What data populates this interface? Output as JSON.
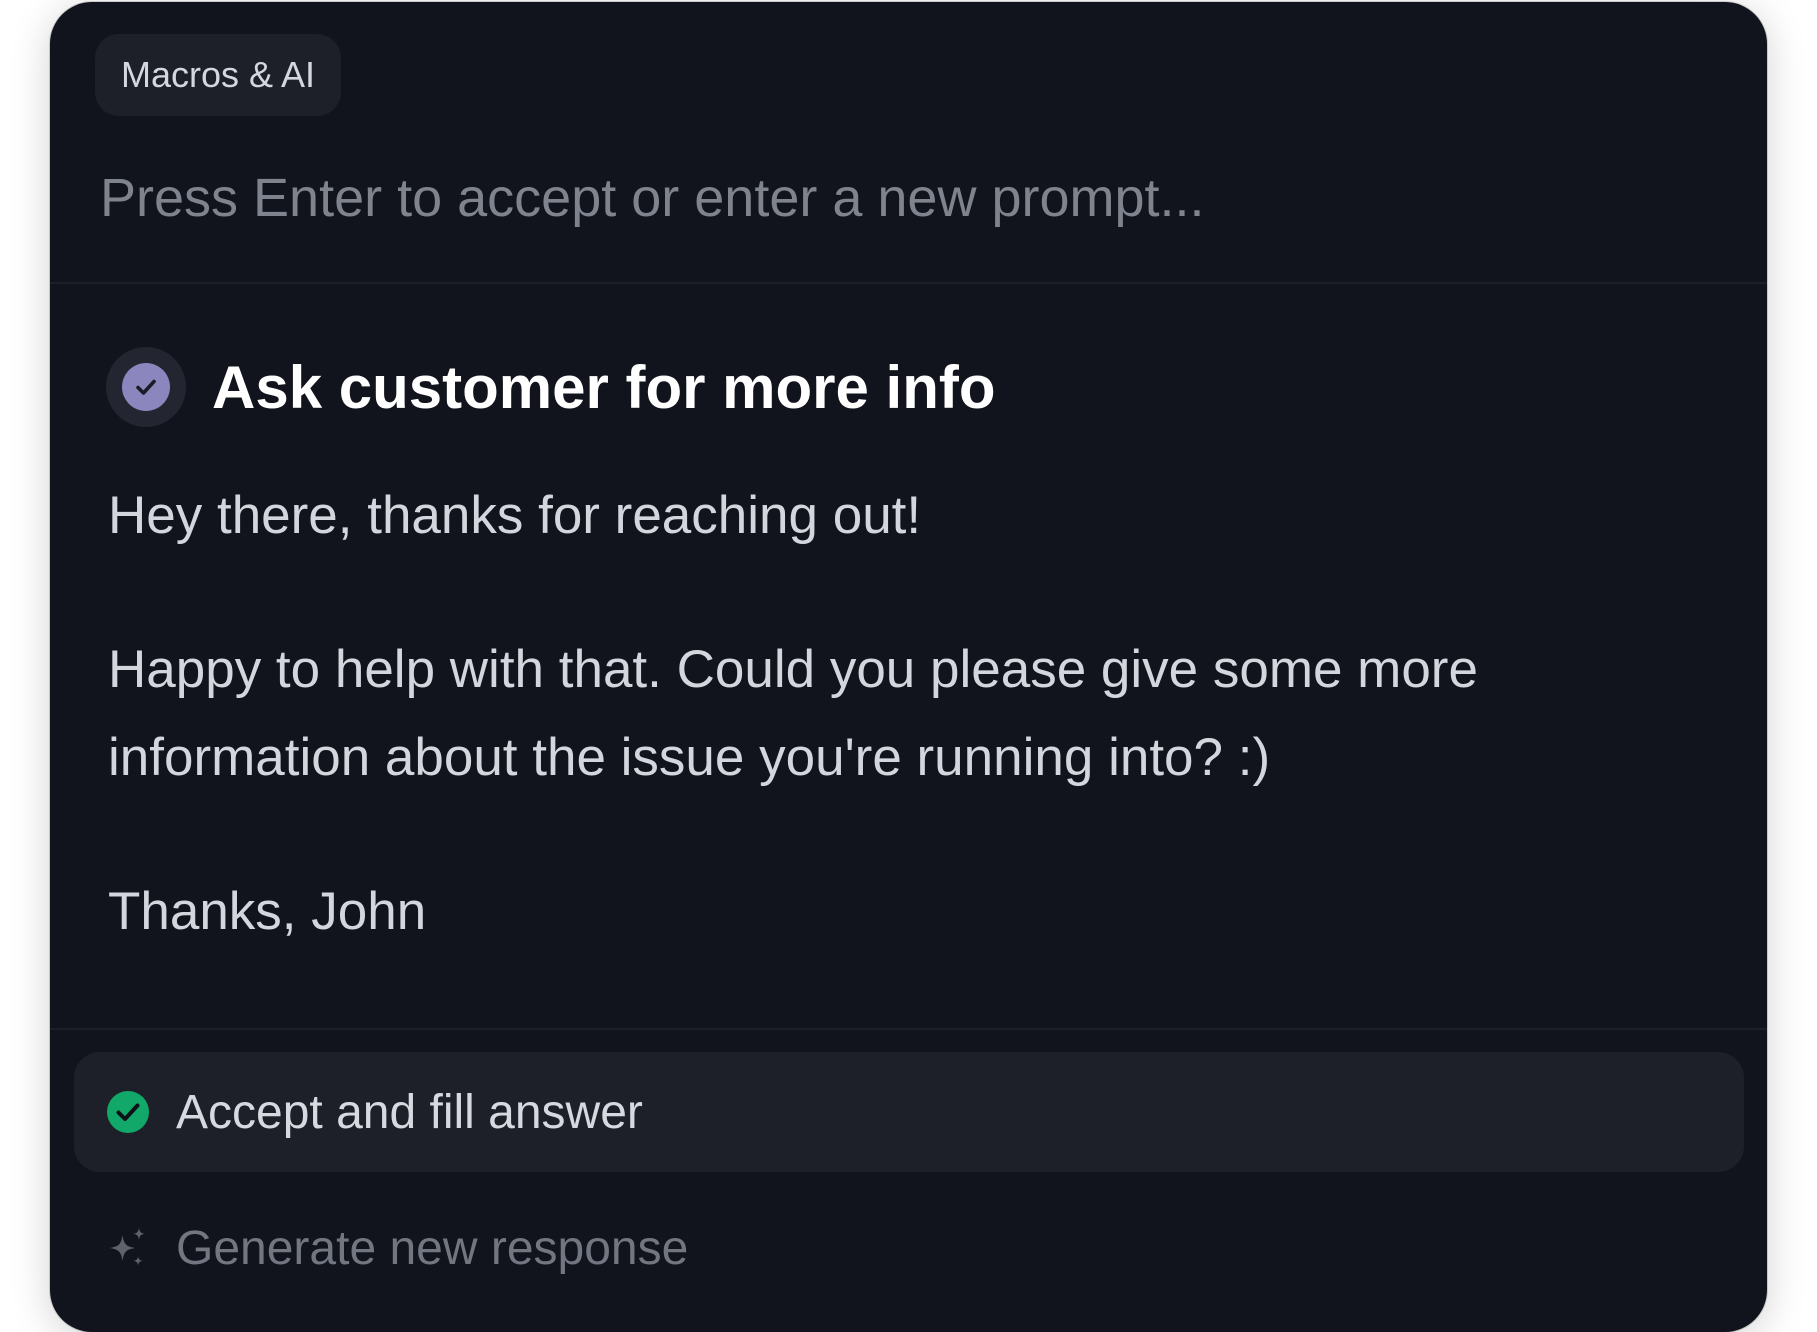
{
  "header": {
    "tag_label": "Macros & AI"
  },
  "prompt": {
    "placeholder": "Press Enter to accept or enter a new prompt...",
    "value": ""
  },
  "macro": {
    "title": "Ask customer for more info",
    "icon": "check-circle-icon",
    "lines": [
      "Hey there, thanks for reaching out!",
      "Happy to help with that. Could you please give some more",
      "information about the issue you're running into? :)",
      "Thanks, John"
    ]
  },
  "actions": [
    {
      "label": "Accept and fill answer",
      "icon": "green-check-icon",
      "selected": true
    },
    {
      "label": "Generate new response",
      "icon": "sparkles-icon",
      "selected": false
    }
  ],
  "colors": {
    "panel_bg": "#11141c",
    "accent_purple": "#8c86bf",
    "accept_green": "#12a86a",
    "muted_text": "#7f838d"
  }
}
